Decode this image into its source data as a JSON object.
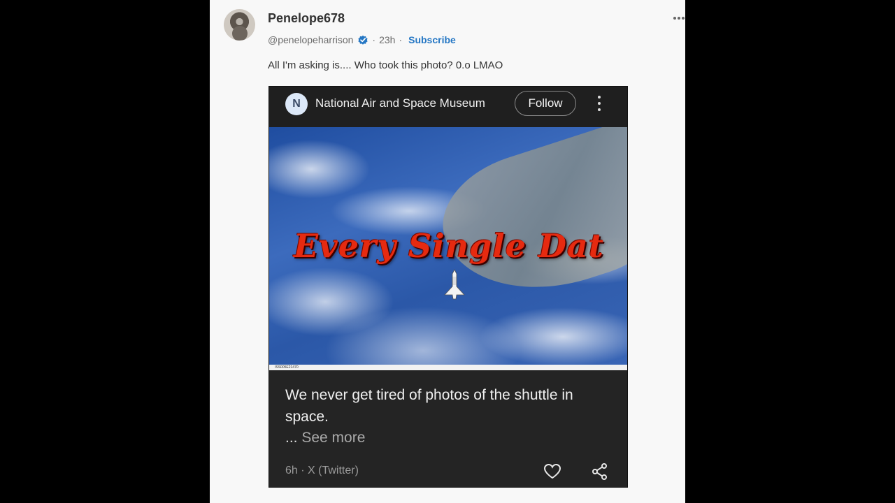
{
  "post": {
    "username": "Penelope678",
    "handle": "@penelopeharrison",
    "time": "23h",
    "separator": "·",
    "subscribe_label": "Subscribe",
    "text": "All I'm asking is.... Who took this photo? 0.o LMAO",
    "icons": {
      "verified": "verified-badge-icon",
      "more": "more-horizontal-icon"
    }
  },
  "embed": {
    "source_initial": "N",
    "source_name": "National Air and Space Museum",
    "follow_label": "Follow",
    "overlay_text": "Every Single Dat",
    "photo_id": "ISS005E21470",
    "caption": "We never get tired of photos of the shuttle in space.",
    "see_more_prefix": "...",
    "see_more_label": "See more",
    "footer_meta": "6h · X (Twitter)",
    "icons": {
      "like": "heart-icon",
      "share": "share-icon",
      "menu": "more-vertical-icon"
    }
  },
  "colors": {
    "page_bg": "#000000",
    "panel_bg": "#f8f8f8",
    "accent": "#2577c4",
    "card_bg": "#242424",
    "overlay_red": "#e62a10"
  }
}
